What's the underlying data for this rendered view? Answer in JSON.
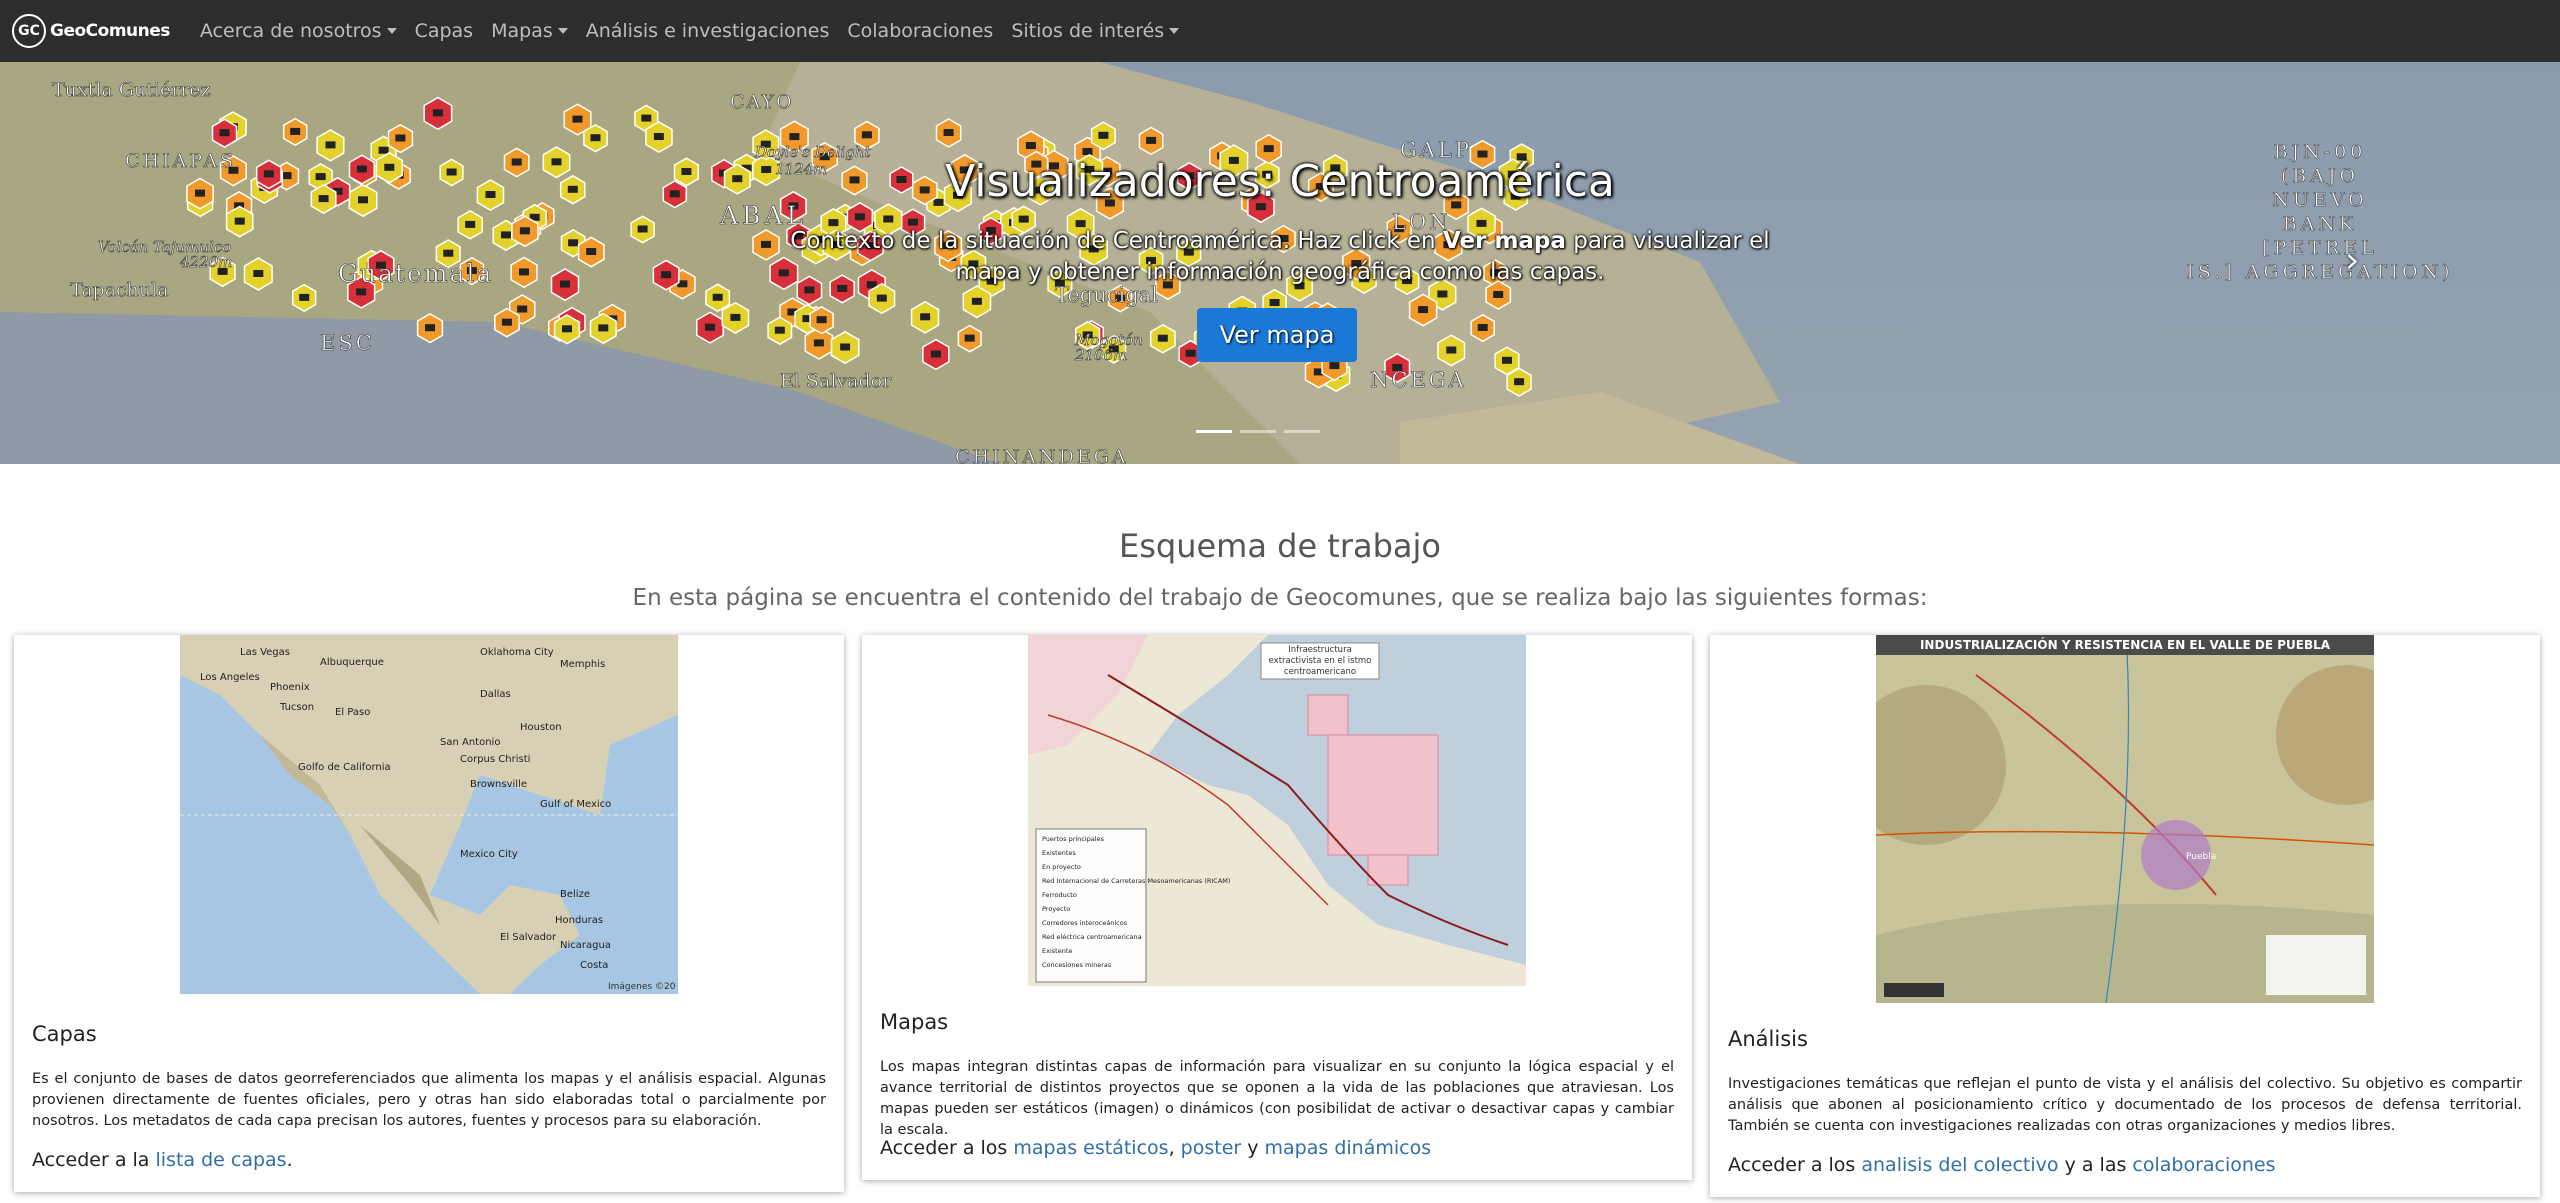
{
  "nav": {
    "logo_mark": "GC",
    "logo_text": "GeoComunes",
    "items": [
      {
        "label": "Acerca de nosotros",
        "dropdown": true
      },
      {
        "label": "Capas",
        "dropdown": false
      },
      {
        "label": "Mapas",
        "dropdown": true
      },
      {
        "label": "Análisis e investigaciones",
        "dropdown": false
      },
      {
        "label": "Colaboraciones",
        "dropdown": false
      },
      {
        "label": "Sitios de interés",
        "dropdown": true
      }
    ]
  },
  "hero": {
    "title": "Visualizadores: Centroamérica",
    "sub_pre": "Contexto de la situación de Centroamérica. Haz click en ",
    "sub_bold": "Ver mapa",
    "sub_post": " para visualizar el mapa y obtener información geográfica como las capas.",
    "button": "Ver mapa",
    "next_glyph": "›",
    "map_labels": [
      "Tuxtla Gutiérrez",
      "CHIAPAS",
      "CAYO",
      "Doyle's Delight",
      "1124m",
      "Volcán Tajumulco",
      "4220m",
      "Tapachula",
      "Guatemala",
      "ESC",
      "BJN-00",
      "(BAJO",
      "NUEVO",
      "BANK",
      "[PETREL",
      "IS.] AGGREGATION)",
      "LON",
      "NCEGA",
      "CHINANDEGA",
      "GALP",
      "Mogotón",
      "2106m",
      "Tegucigal",
      "El Salvador",
      "ABAL"
    ]
  },
  "section": {
    "title": "Esquema de trabajo",
    "subtitle": "En esta página se encuentra el contenido del trabajo de Geocomunes, que se realiza bajo las siguientes formas:"
  },
  "cards": [
    {
      "title": "Capas",
      "text": "Es el conjunto de bases de datos georreferenciados que alimenta los mapas y el análisis espacial. Algunas provienen directamente de fuentes oficiales, pero y otras han sido elaboradas total o parcialmente por nosotros. Los metadatos de cada capa precisan los autores, fuentes y procesos para su elaboración.",
      "access_pre": "Acceder a la ",
      "link1": "lista de capas",
      "access_post": ".",
      "map_labels": [
        "Las Vegas",
        "Los Angeles",
        "Phoenix",
        "Albuquerque",
        "Oklahoma City",
        "Memphis",
        "Dallas",
        "Tucson",
        "El Paso",
        "Houston",
        "San Antonio",
        "Corpus Christi",
        "Brownsville",
        "Golfo de California",
        "Gulf of Mexico",
        "Mexico City",
        "Belize",
        "Honduras",
        "El Salvador",
        "Nicaragua",
        "Costa",
        "Imágenes ©20"
      ]
    },
    {
      "title": "Mapas",
      "text": "Los mapas integran distintas capas de información para visualizar en su conjunto la lógica espacial y el avance territorial de distintos proyectos que se oponen a la vida de las poblaciones que atraviesan. Los mapas pueden ser estáticos (imagen) o dinámicos (con posibilidat de activar o desactivar capas y cambiar la escala.",
      "access_pre": "Acceder a los ",
      "link1": "mapas estáticos",
      "sep1": ", ",
      "link2": "poster",
      "sep2": " y ",
      "link3": "mapas dinámicos",
      "map_title": "Infraestructura extractivista en el istmo centroamericano",
      "legend": [
        "Puertos principales",
        "Existentes",
        "En proyecto",
        "Red Internacional de Carreteras Mesoamericanas (RICAM)",
        "Ferroducto",
        "Proyecto",
        "Corredores interoceánicos",
        "Red eléctrica centroamericana",
        "Existente",
        "Concesiones mineras"
      ]
    },
    {
      "title": "Análisis",
      "text": "Investigaciones temáticas que reflejan el punto de vista y el análisis del colectivo. Su objetivo es compartir análisis que abonen al posicionamiento crítico y documentado de los procesos de defensa territorial. También se cuenta con investigaciones realizadas con otras organizaciones y medios libres.",
      "access_pre": "Acceder a los ",
      "link1": "analisis del colectivo",
      "sep1": " y a las ",
      "link2": "colaboraciones",
      "map_title": "INDUSTRIALIZACIÓN Y RESISTENCIA EN EL VALLE DE PUEBLA",
      "place": "Puebla"
    }
  ],
  "colors": {
    "navbar": "#2c2d2f",
    "accent_button": "#1a78d6",
    "link": "#2f6fa9",
    "marker_yellow": "#e3d22b",
    "marker_orange": "#ef9a2a",
    "marker_red": "#d7303a"
  }
}
